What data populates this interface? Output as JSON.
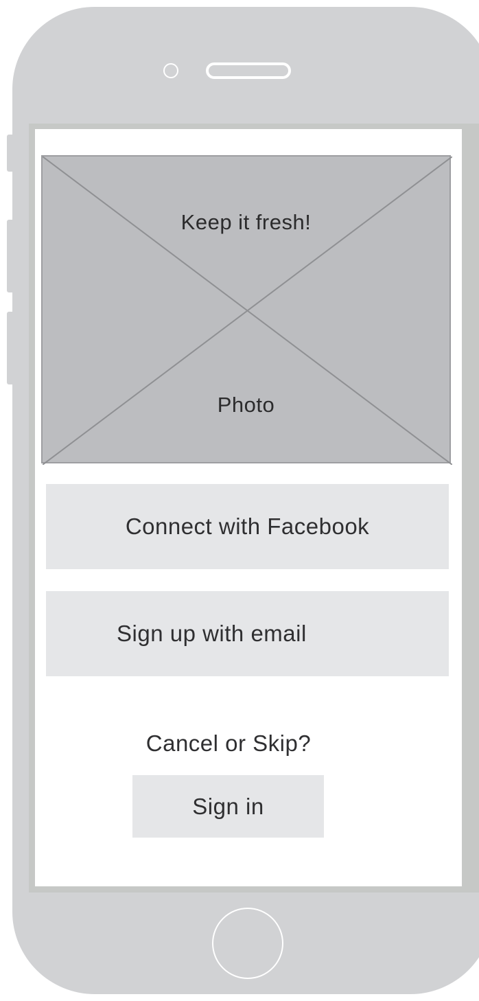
{
  "photo": {
    "title": "Keep it fresh!",
    "label": "Photo"
  },
  "actions": {
    "facebook_label": "Connect with Facebook",
    "email_label": "Sign up with email",
    "cancel_label": "Cancel or Skip?",
    "signin_label": "Sign in"
  },
  "colors": {
    "device_body": "#d1d2d4",
    "placeholder_fill": "#bcbdc0",
    "button_fill": "#e5e6e8",
    "text": "#2f2f31"
  },
  "icons": {
    "camera": "camera-icon",
    "speaker": "speaker-icon",
    "home": "home-button-icon"
  }
}
